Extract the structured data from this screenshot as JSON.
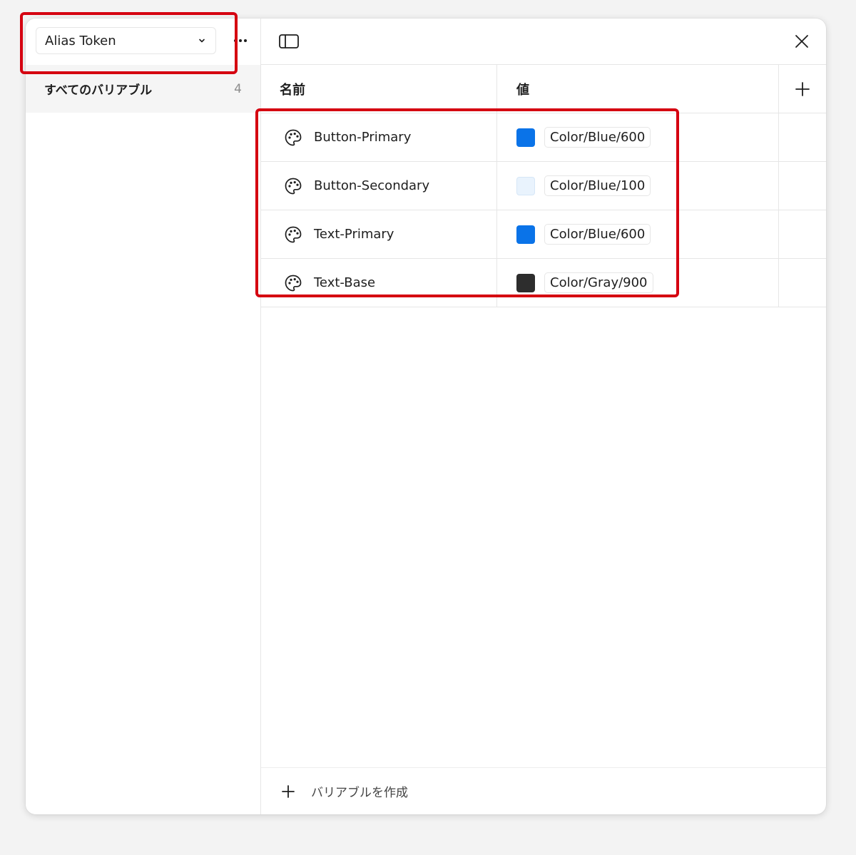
{
  "sidebar": {
    "collection_selector": {
      "label": "Alias Token"
    },
    "groups": [
      {
        "label": "すべてのバリアブル",
        "count": "4"
      }
    ]
  },
  "table": {
    "headers": {
      "name": "名前",
      "value": "値"
    },
    "rows": [
      {
        "name": "Button-Primary",
        "value": "Color/Blue/600",
        "swatch_color": "#0a73e8"
      },
      {
        "name": "Button-Secondary",
        "value": "Color/Blue/100",
        "swatch_color": "#e9f3fd"
      },
      {
        "name": "Text-Primary",
        "value": "Color/Blue/600",
        "swatch_color": "#0a73e8"
      },
      {
        "name": "Text-Base",
        "value": "Color/Gray/900",
        "swatch_color": "#2d2d2d"
      }
    ]
  },
  "footer": {
    "create_label": "バリアブルを作成"
  },
  "icons": {
    "variable_type": "palette-icon",
    "panel_toggle": "sidebar-panel-icon",
    "close": "close-icon",
    "add_column": "plus-icon",
    "more": "ellipsis-icon",
    "dropdown": "chevron-down-icon"
  },
  "colors": {
    "annotation_highlight": "#d50010",
    "selected_group_bg": "#f5f5f5"
  }
}
